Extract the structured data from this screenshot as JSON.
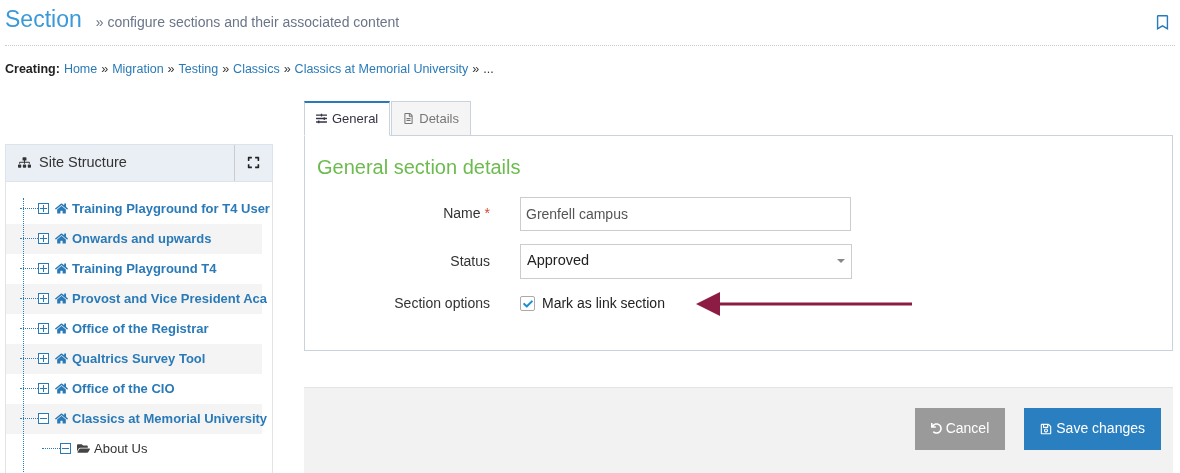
{
  "header": {
    "title": "Section",
    "subtitle": "» configure sections and their associated content"
  },
  "breadcrumb": {
    "label": "Creating:",
    "links": [
      "Home",
      "Migration",
      "Testing",
      "Classics",
      "Classics at Memorial University"
    ],
    "separator": "»",
    "trailing": "..."
  },
  "sidebar": {
    "title": "Site Structure",
    "tree": [
      {
        "label": "Training Playground for T4 User",
        "kind": "site",
        "expanded": false
      },
      {
        "label": "Onwards and upwards",
        "kind": "site",
        "expanded": false
      },
      {
        "label": "Training Playground T4",
        "kind": "site",
        "expanded": false
      },
      {
        "label": "Provost and Vice President Aca",
        "kind": "site",
        "expanded": false
      },
      {
        "label": "Office of the Registrar",
        "kind": "site",
        "expanded": false
      },
      {
        "label": "Qualtrics Survey Tool",
        "kind": "site",
        "expanded": false
      },
      {
        "label": "Office of the CIO",
        "kind": "site",
        "expanded": false
      },
      {
        "label": "Classics at Memorial University",
        "kind": "site",
        "expanded": true,
        "children": [
          {
            "label": "About Us",
            "kind": "folder",
            "expanded": true
          }
        ]
      }
    ]
  },
  "tabs": [
    {
      "label": "General",
      "kind": "sliders",
      "selected": true
    },
    {
      "label": "Details",
      "kind": "document",
      "selected": false
    }
  ],
  "form": {
    "heading": "General section details",
    "fields": [
      {
        "kind": "text",
        "label": "Name",
        "required_mark": "*",
        "value": "Grenfell campus"
      },
      {
        "kind": "select",
        "label": "Status",
        "value": "Approved"
      },
      {
        "kind": "checkbox",
        "label": "Section options",
        "option": "Mark as link section",
        "checked": true
      }
    ]
  },
  "buttons": [
    {
      "label": "Cancel",
      "kind": "cancel"
    },
    {
      "label": "Save changes",
      "kind": "save"
    }
  ]
}
